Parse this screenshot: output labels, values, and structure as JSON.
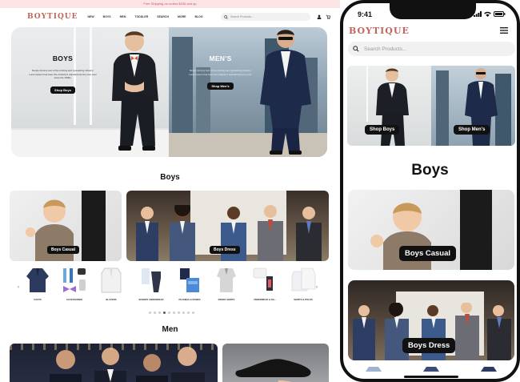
{
  "promo_text": "Free Shipping on orders $150 and up",
  "brand": "BOYTIQUE",
  "desktop": {
    "nav": [
      "NEW",
      "BOYS",
      "MEN",
      "TODDLER",
      "SEARCH",
      "MORE",
      "BLOG"
    ],
    "search_placeholder": "Search Products...",
    "hero": {
      "boys": {
        "title": "BOYS",
        "text": "Simply dummy text of the printing and typesetting industry. Lorem Ipsum has been the industry's standard dummy text ever since the 1500s.",
        "button": "Shop Boys"
      },
      "men": {
        "title": "MEN'S",
        "text": "Simply dummy text of the printing and typesetting industry. Lorem Ipsum has been the industry's standard dummy text.",
        "button": "Shop Men's"
      }
    },
    "boys_title": "Boys",
    "cat_casual": "Boys Casual",
    "cat_dress": "Boys Dress",
    "products": [
      {
        "label": "COATS"
      },
      {
        "label": "ACCESSORIES"
      },
      {
        "label": "BLAZERS"
      },
      {
        "label": "BOXERS UNDERWEAR"
      },
      {
        "label": "PAJAMAS & ROBES"
      },
      {
        "label": "DRESS SHIRTS"
      },
      {
        "label": "UNDERWEAR & SO..."
      },
      {
        "label": "SHIRTS & POLOS"
      }
    ],
    "men_title": "Men"
  },
  "mobile": {
    "time": "9:41",
    "search_placeholder": "Search Products...",
    "hero_boys_button": "Shop Boys",
    "hero_men_button": "Shop Men's",
    "boys_title": "Boys",
    "cat_casual": "Boys Casual",
    "cat_dress": "Boys Dress"
  },
  "colors": {
    "brand": "#c0655b",
    "promo_bg": "#fbe3e6",
    "button": "#111111"
  },
  "icons": [
    "search-icon",
    "user-icon",
    "cart-icon",
    "hamburger-icon",
    "signal-icon",
    "wifi-icon",
    "battery-icon",
    "chevron-left-icon",
    "chevron-right-icon"
  ]
}
